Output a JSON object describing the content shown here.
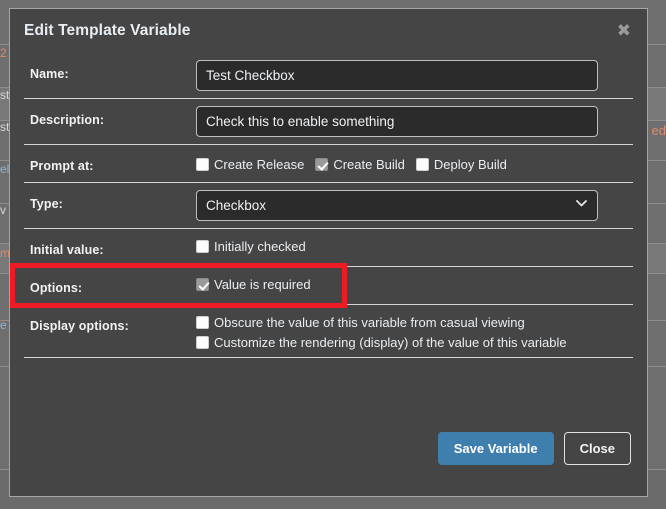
{
  "modal": {
    "title": "Edit Template Variable",
    "close_icon": "close-icon",
    "close_glyph": "✖"
  },
  "form": {
    "name": {
      "label": "Name:",
      "value": "Test Checkbox",
      "placeholder": ""
    },
    "description": {
      "label": "Description:",
      "value": "Check this to enable something",
      "placeholder": ""
    },
    "prompt_at": {
      "label": "Prompt at:",
      "options": [
        {
          "label": "Create Release",
          "checked": false
        },
        {
          "label": "Create Build",
          "checked": true
        },
        {
          "label": "Deploy Build",
          "checked": false
        }
      ]
    },
    "type": {
      "label": "Type:",
      "value": "Checkbox",
      "chevron_icon": "chevron-down-icon",
      "chevron_glyph": "❯",
      "options": [
        "Checkbox"
      ]
    },
    "initial_value": {
      "label": "Initial value:",
      "options": [
        {
          "label": "Initially checked",
          "checked": false
        }
      ]
    },
    "options": {
      "label": "Options:",
      "items": [
        {
          "label": "Value is required",
          "checked": true
        }
      ]
    },
    "display_options": {
      "label": "Display options:",
      "items": [
        {
          "label": "Obscure the value of this variable from casual viewing",
          "checked": false
        },
        {
          "label": "Customize the rendering (display) of the value of this variable",
          "checked": false
        }
      ]
    }
  },
  "footer": {
    "save_label": "Save Variable",
    "close_label": "Close"
  },
  "annotation": {
    "color": "#ed1c24",
    "target": "initial-value-row"
  },
  "backdrop": {
    "fragment_right": "ed",
    "fragment_left_1": "2",
    "fragment_left_2": "st",
    "fragment_left_3": "st",
    "fragment_left_4": "el",
    "fragment_left_5": "v",
    "fragment_left_6": "m",
    "fragment_left_7": "e"
  },
  "colors": {
    "modal_bg": "#454545",
    "page_bg": "#6e6e6e",
    "input_bg": "#2b2b2b",
    "primary_button": "#3f7fad",
    "text": "#e9eef2",
    "accent_red": "#ed1c24"
  }
}
